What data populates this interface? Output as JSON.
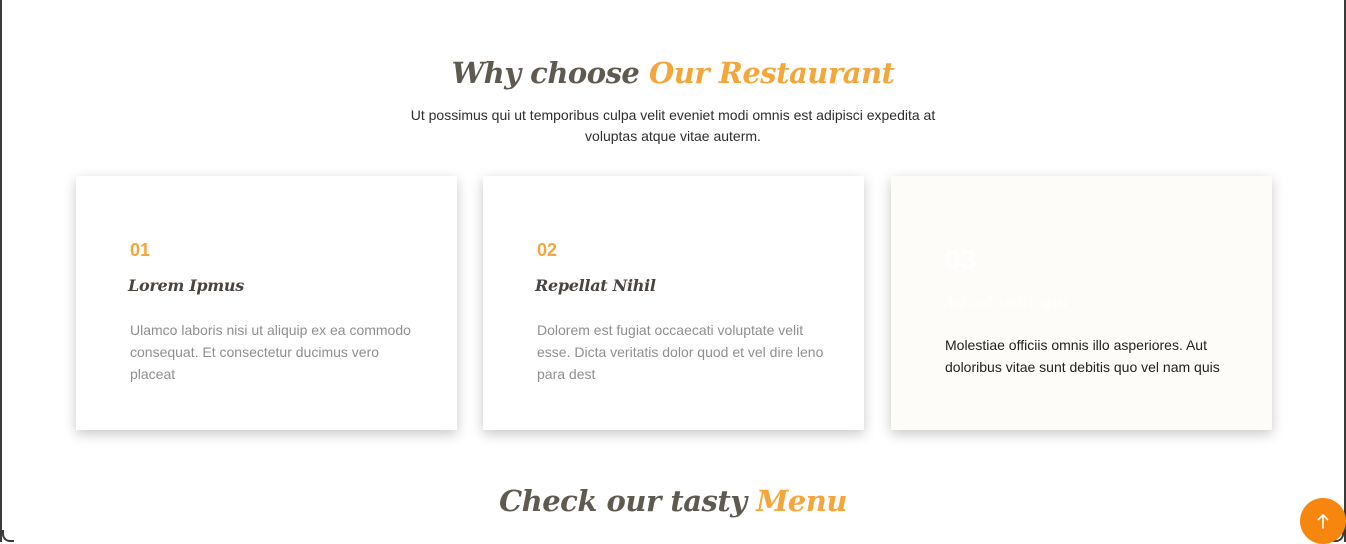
{
  "why_section": {
    "title_prefix": "Why choose",
    "title_accent": "Our Restaurant",
    "description": "Ut possimus qui ut temporibus culpa velit eveniet modi omnis est adipisci expedita at voluptas atque vitae auterm."
  },
  "cards": [
    {
      "number": "01",
      "title": "Lorem Ipmus",
      "text": "Ulamco laboris nisi ut aliquip ex ea commodo consequat. Et consectetur ducimus vero placeat"
    },
    {
      "number": "02",
      "title": "Repellat Nihil",
      "text": "Dolorem est fugiat occaecati voluptate velit esse. Dicta veritatis dolor quod et vel dire leno para dest"
    },
    {
      "number": "03",
      "title": "Ad ad velit qui",
      "text": "Molestiae officiis omnis illo asperiores. Aut doloribus vitae sunt debitis quo vel nam quis"
    }
  ],
  "menu_section": {
    "title_prefix": "Check our tasty",
    "title_accent": "Menu"
  },
  "back_to_top": {
    "icon": "arrow-up-icon",
    "color": "#f7860f"
  },
  "colors": {
    "accent": "#f4a63a",
    "heading": "#5f5950"
  }
}
